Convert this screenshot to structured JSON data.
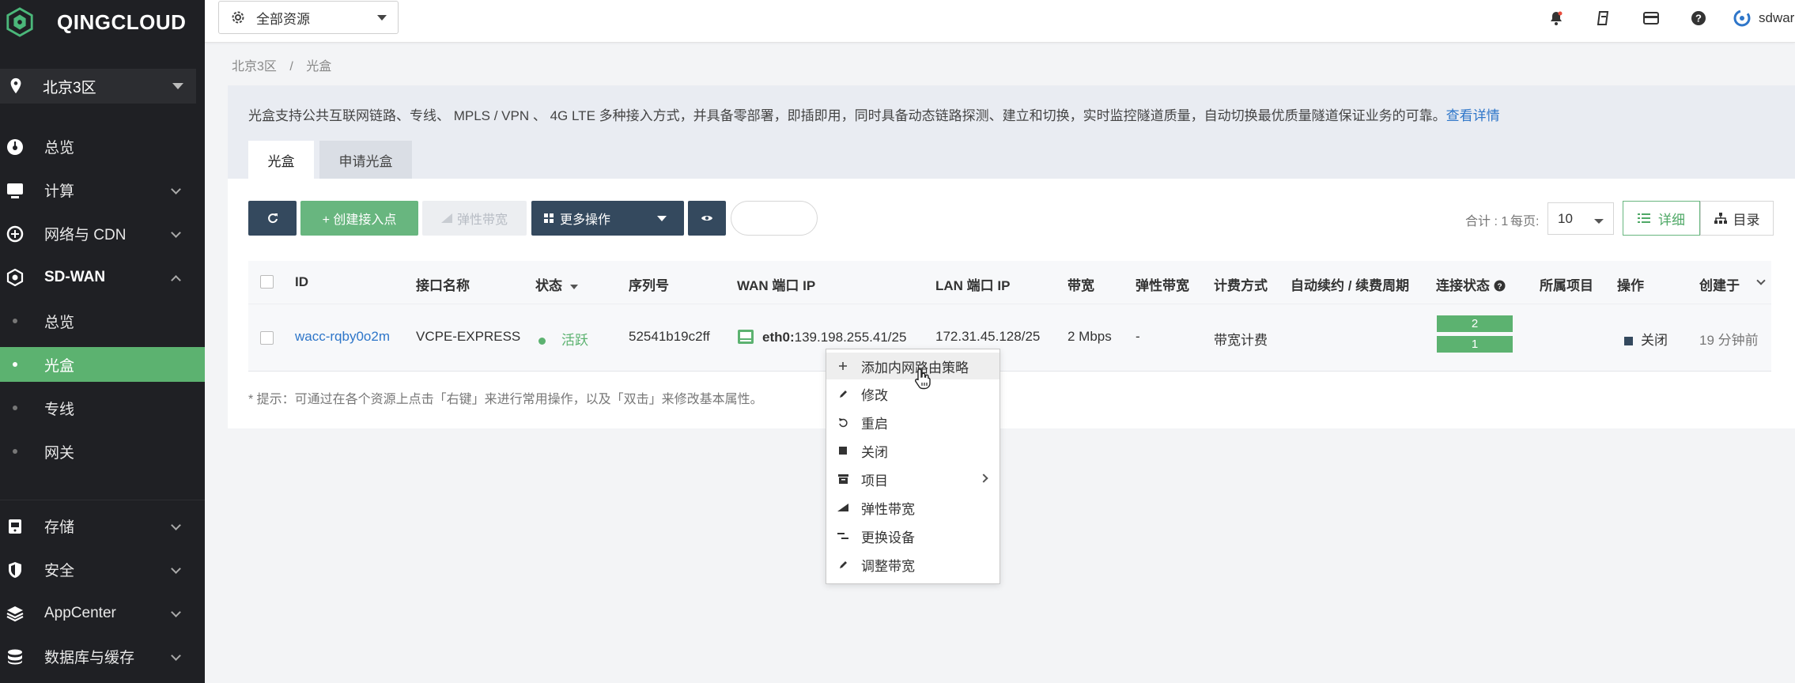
{
  "brand": {
    "name": "QINGCLOUD"
  },
  "sidebar": {
    "region": "北京3区",
    "items": [
      {
        "label": "总览",
        "icon": "dashboard-icon"
      },
      {
        "label": "计算",
        "icon": "compute-icon"
      },
      {
        "label": "网络与 CDN",
        "icon": "network-icon"
      },
      {
        "label": "SD-WAN",
        "icon": "sdwan-icon",
        "expanded": true,
        "children": [
          "总览",
          "光盒",
          "专线",
          "网关"
        ],
        "active_child": "光盒"
      },
      {
        "label": "存储",
        "icon": "storage-icon"
      },
      {
        "label": "安全",
        "icon": "shield-icon"
      },
      {
        "label": "AppCenter",
        "icon": "appcenter-icon"
      },
      {
        "label": "数据库与缓存",
        "icon": "database-icon"
      }
    ]
  },
  "topbar": {
    "resource_select": "全部资源",
    "icons": [
      "bell-icon",
      "ticket-icon",
      "card-icon",
      "help-icon"
    ],
    "user": "sdwar"
  },
  "breadcrumb": [
    "北京3区",
    "/",
    "光盒"
  ],
  "info": {
    "text": "光盒支持公共互联网链路、专线、 MPLS / VPN 、 4G LTE 多种接入方式，并具备零部署，即插即用，同时具备动态链路探测、建立和切换，实时监控隧道质量，自动切换最优质量隧道保证业务的可靠。",
    "link": "查看详情"
  },
  "tabs": [
    "光盒",
    "申请光盒"
  ],
  "toolbar": {
    "create": "+ 创建接入点",
    "elastic": "弹性带宽",
    "more": "更多操作",
    "total": "合计 : 1",
    "per_page_label": "每页:",
    "per_page": "10",
    "view_detail": "详细",
    "view_dir": "目录"
  },
  "table": {
    "headers": [
      "ID",
      "接口名称",
      "状态",
      "序列号",
      "WAN 端口 IP",
      "LAN 端口 IP",
      "带宽",
      "弹性带宽",
      "计费方式",
      "自动续约 / 续费周期",
      "连接状态",
      "所属项目",
      "操作",
      "创建于"
    ],
    "row": {
      "id": "wacc-rqby0o2m",
      "name": "VCPE-EXPRESS",
      "status": "活跃",
      "serial": "52541b19c2ff",
      "wan_prefix": "eth0:",
      "wan_ip": "139.198.255.41/25",
      "lan_ip": "172.31.45.128/25",
      "bandwidth": "2 Mbps",
      "elastic": "-",
      "billing": "带宽计费",
      "conn": [
        "2",
        "1"
      ],
      "op": "关闭",
      "created": "19 分钟前"
    }
  },
  "hint": "* 提示：可通过在各个资源上点击「右键」来进行常用操作，以及「双击」来修改基本属性。",
  "context_menu": [
    {
      "label": "添加内网路由策略",
      "icon": "plus-icon"
    },
    {
      "label": "修改",
      "icon": "pencil-icon"
    },
    {
      "label": "重启",
      "icon": "restart-icon"
    },
    {
      "label": "关闭",
      "icon": "stop-icon"
    },
    {
      "label": "项目",
      "icon": "project-icon",
      "submenu": true
    },
    {
      "label": "弹性带宽",
      "icon": "chart-icon"
    },
    {
      "label": "更换设备",
      "icon": "swap-icon"
    },
    {
      "label": "调整带宽",
      "icon": "pencil-icon"
    }
  ]
}
